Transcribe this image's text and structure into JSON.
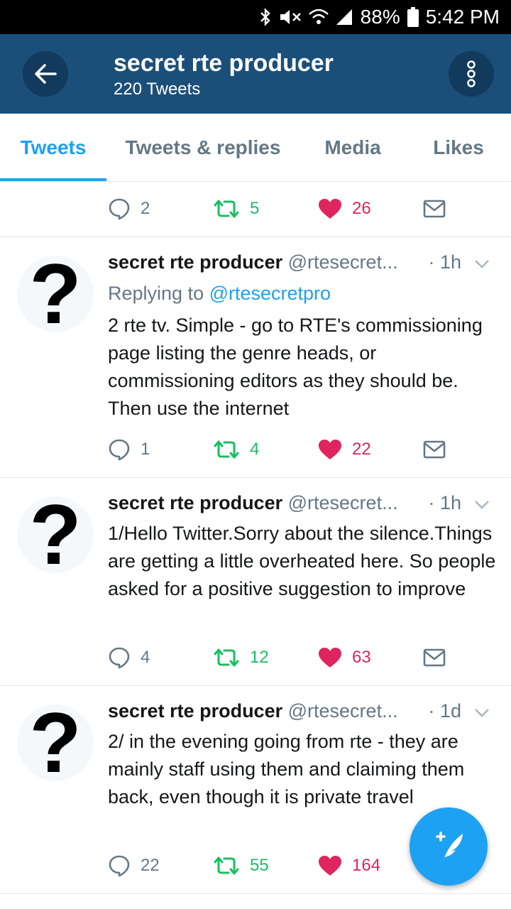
{
  "status_bar": {
    "battery": "88%",
    "time": "5:42 PM"
  },
  "header": {
    "title": "secret rte producer",
    "subtitle": "220 Tweets"
  },
  "tabs": [
    {
      "label": "Tweets",
      "active": true
    },
    {
      "label": "Tweets & replies",
      "active": false
    },
    {
      "label": "Media",
      "active": false
    },
    {
      "label": "Likes",
      "active": false
    }
  ],
  "partial_tweet": {
    "replies": "2",
    "retweets": "5",
    "likes": "26"
  },
  "tweets": [
    {
      "name": "secret rte producer",
      "handle": "@rtesecret...",
      "time": "· 1h",
      "replying_prefix": "Replying to ",
      "replying_to": "@rtesecretpro",
      "text": "2 rte tv. Simple - go to RTE's commissioning page listing the genre heads, or commissioning editors as they should be. Then use the internet",
      "replies": "1",
      "retweets": "4",
      "likes": "22"
    },
    {
      "name": "secret rte producer",
      "handle": "@rtesecret...",
      "time": "· 1h",
      "text": "1/Hello Twitter.Sorry about the silence.Things are getting a little overheated here. So people asked for a positive suggestion to improve",
      "replies": "4",
      "retweets": "12",
      "likes": "63"
    },
    {
      "name": "secret rte producer",
      "handle": "@rtesecret...",
      "time": "· 1d",
      "text": "2/ in the evening going from rte - they are mainly staff using them and claiming them back, even though it is private travel",
      "replies": "22",
      "retweets": "55",
      "likes": "164"
    }
  ],
  "avatar_glyph": "?",
  "colors": {
    "accent": "#1da1f2",
    "header_bg": "#1b4f7a",
    "retweet": "#17bf63",
    "like": "#e0245e"
  },
  "icons": [
    "back-arrow-icon",
    "more-vert-icon",
    "reply-icon",
    "retweet-icon",
    "heart-icon",
    "mail-icon",
    "chevron-down-icon",
    "compose-tweet-icon"
  ]
}
